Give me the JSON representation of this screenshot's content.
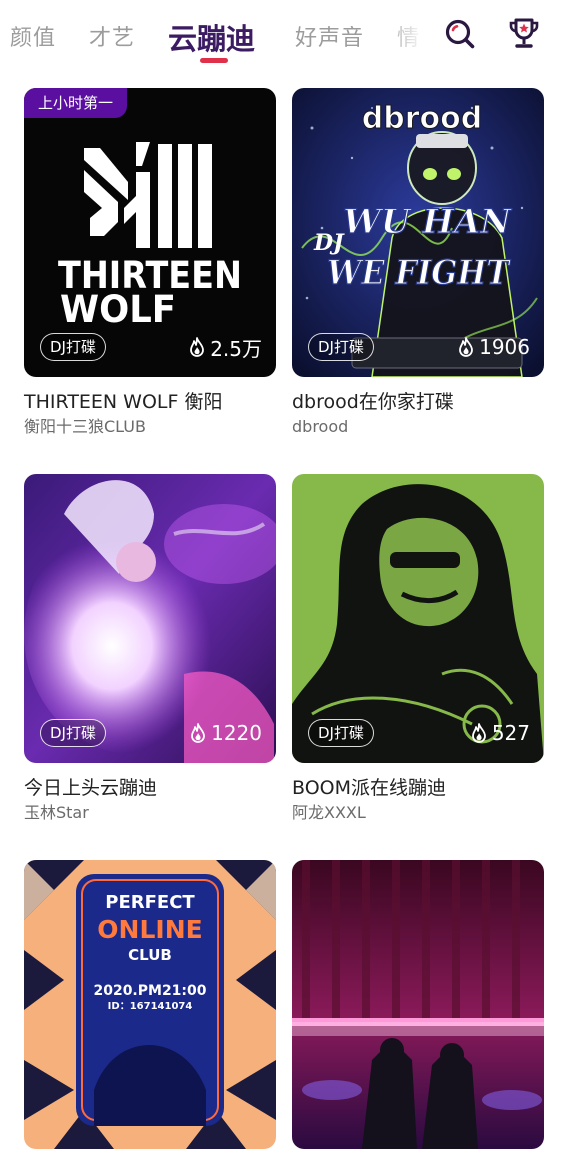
{
  "tabs": [
    {
      "label": "颜值",
      "active": false
    },
    {
      "label": "才艺",
      "active": false
    },
    {
      "label": "云蹦迪",
      "active": true
    },
    {
      "label": "好声音",
      "active": false
    },
    {
      "label": "情",
      "active": false
    }
  ],
  "header_icons": [
    "search-icon",
    "trophy-icon"
  ],
  "colors": {
    "active_tab": "#3b1b62",
    "indicator": "#e0314b",
    "rank_badge": "#5a0fa0"
  },
  "cards": [
    {
      "title": "THIRTEEN WOLF 衡阳",
      "host": "衡阳十三狼CLUB",
      "tag": "DJ打碟",
      "heat": "2.5万",
      "rank_badge": "上小时第一",
      "art_text": [
        "THIRTEEN",
        "WOLF"
      ]
    },
    {
      "title": "dbrood在你家打碟",
      "host": "dbrood",
      "tag": "DJ打碟",
      "heat": "1906",
      "art_text": [
        "dbrood",
        "WU HAN",
        "WE FIGHT",
        "DJ"
      ]
    },
    {
      "title": "今日上头云蹦迪",
      "host": "玉林Star",
      "tag": "DJ打碟",
      "heat": "1220"
    },
    {
      "title": "BOOM派在线蹦迪",
      "host": "阿龙XXXL",
      "tag": "DJ打碟",
      "heat": "527"
    },
    {
      "art_text": [
        "PERFECT",
        "ONLINE",
        "CLUB",
        "2020.PM21:00",
        "ID：167141074"
      ]
    },
    {}
  ]
}
